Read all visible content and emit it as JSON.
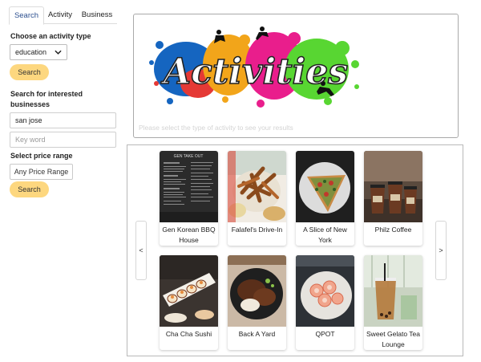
{
  "tabs": [
    {
      "label": "Search",
      "active": true
    },
    {
      "label": "Activity",
      "active": false
    },
    {
      "label": "Business",
      "active": false
    }
  ],
  "sidebar": {
    "activity_type_label": "Choose an activity type",
    "activity_type_value": "education",
    "search_button_1": "Search",
    "business_search_label": "Search for interested businesses",
    "location_value": "san jose",
    "keyword_placeholder": "Key word",
    "price_label": "Select price range",
    "price_button": "Any Price Range",
    "search_button_2": "Search"
  },
  "results": {
    "banner_text": "Activities",
    "hint": "Please select the type of activity to see your results"
  },
  "carousel": {
    "prev_label": "<",
    "next_label": ">",
    "cards": [
      {
        "name": "Gen Korean BBQ House",
        "photo": "menu-photo",
        "menu_title": "GEN TAKE OUT"
      },
      {
        "name": "Falafel's Drive-In",
        "photo": "fries-photo"
      },
      {
        "name": "A Slice of New York",
        "photo": "pizza-photo"
      },
      {
        "name": "Philz Coffee",
        "photo": "coffee-photo"
      },
      {
        "name": "Cha Cha Sushi",
        "photo": "sushi-photo"
      },
      {
        "name": "Back A Yard",
        "photo": "jerk-chicken-photo"
      },
      {
        "name": "QPOT",
        "photo": "hotpot-photo"
      },
      {
        "name": "Sweet Gelato Tea Lounge",
        "photo": "milk-tea-photo"
      }
    ]
  },
  "colors": {
    "accent_button": "#fdd77f",
    "active_tab_text": "#2c4f8f",
    "hint_text": "#d4d4d4"
  }
}
